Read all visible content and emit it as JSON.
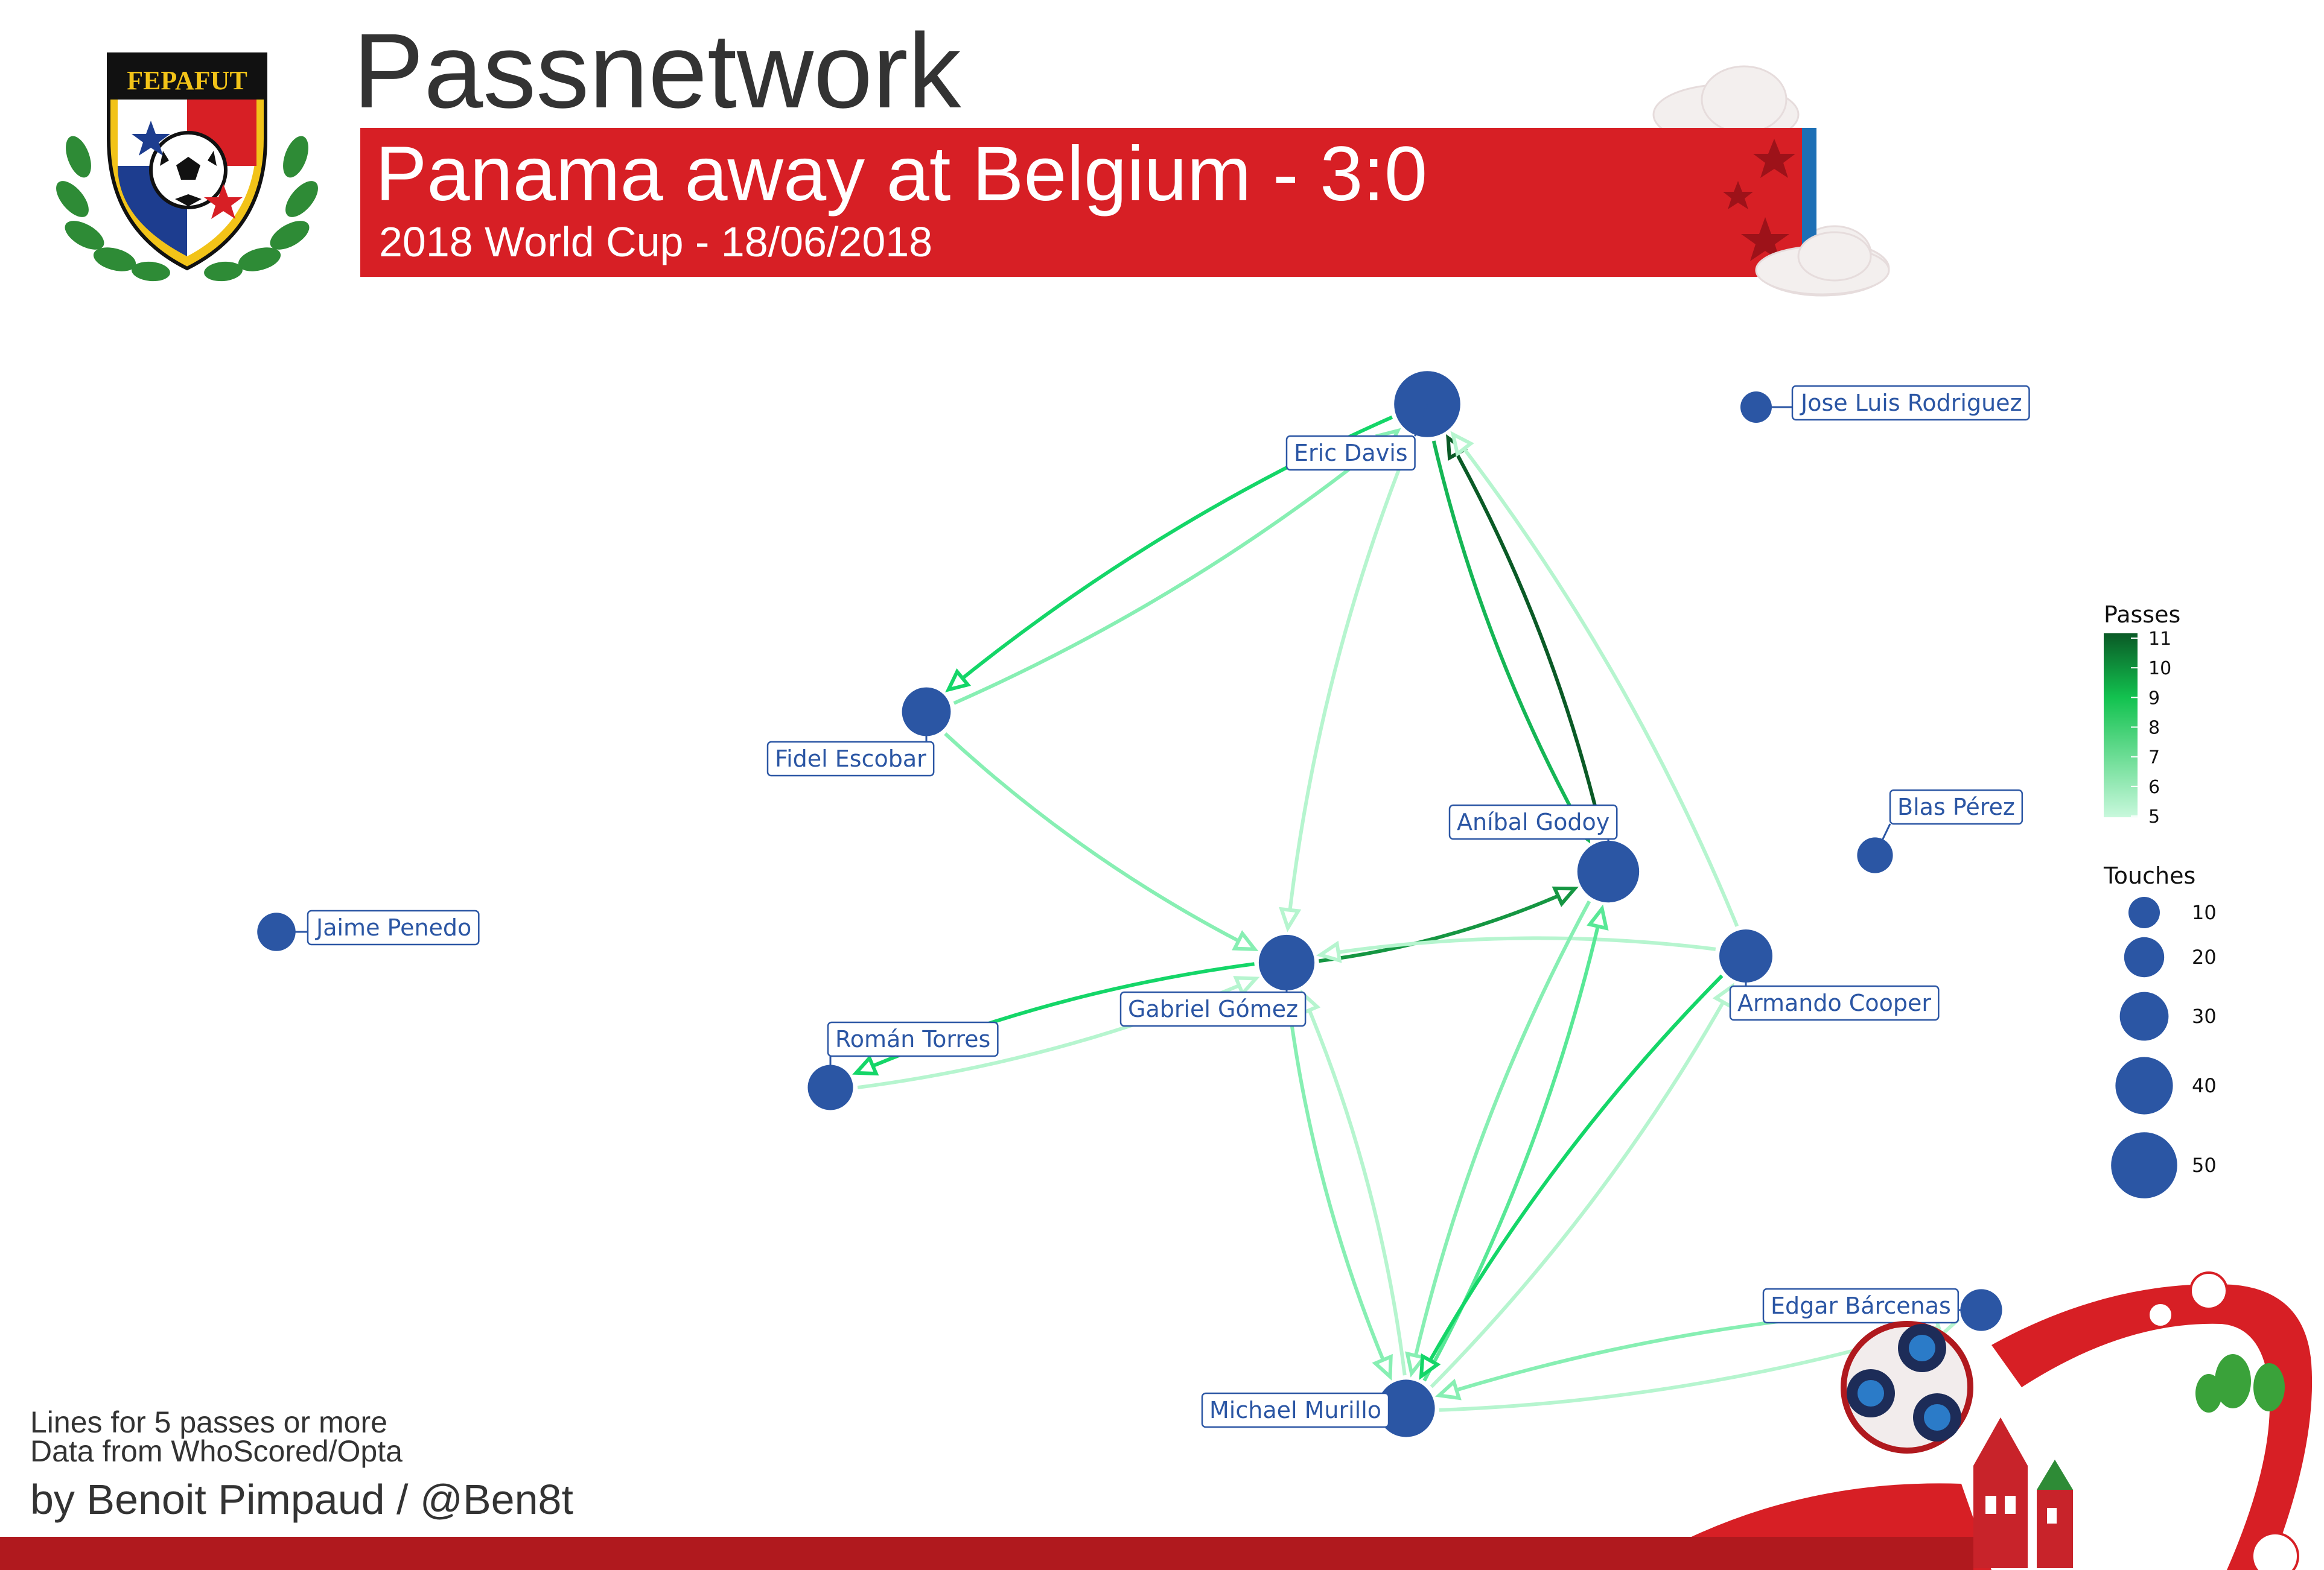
{
  "title": "Passnetwork",
  "banner": {
    "headline": "Panama away at Belgium - 3:0",
    "subline": "2018 World Cup - 18/06/2018"
  },
  "crest_text": "FEPAFUT",
  "footer": {
    "line1": "Lines for 5 passes or more",
    "line2": "Data from WhoScored/Opta",
    "credit": "by Benoit Pimpaud / @Ben8t"
  },
  "colors": {
    "node": "#2b56a4",
    "banner_red": "#d71f25",
    "banner_blue": "#1d6fb5",
    "edge_low": "#b6f5cf",
    "edge_high": "#0a5a26"
  },
  "players": [
    {
      "id": "davis",
      "name": "Eric Davis",
      "touches": 50
    },
    {
      "id": "rodriguez",
      "name": "Jose Luis Rodriguez",
      "touches": 10
    },
    {
      "id": "escobar",
      "name": "Fidel Escobar",
      "touches": 30
    },
    {
      "id": "godoy",
      "name": "Aníbal Godoy",
      "touches": 45
    },
    {
      "id": "perez",
      "name": "Blas Pérez",
      "touches": 15
    },
    {
      "id": "penedo",
      "name": "Jaime Penedo",
      "touches": 18
    },
    {
      "id": "gomez",
      "name": "Gabriel Gómez",
      "touches": 38
    },
    {
      "id": "cooper",
      "name": "Armando Cooper",
      "touches": 35
    },
    {
      "id": "torres",
      "name": "Román Torres",
      "touches": 26
    },
    {
      "id": "barcenas",
      "name": "Edgar Bárcenas",
      "touches": 22
    },
    {
      "id": "murillo",
      "name": "Michael Murillo",
      "touches": 40
    }
  ],
  "passes": [
    {
      "from": "davis",
      "to": "escobar",
      "count": 8
    },
    {
      "from": "escobar",
      "to": "davis",
      "count": 6
    },
    {
      "from": "godoy",
      "to": "davis",
      "count": 11
    },
    {
      "from": "davis",
      "to": "godoy",
      "count": 9
    },
    {
      "from": "davis",
      "to": "gomez",
      "count": 5
    },
    {
      "from": "escobar",
      "to": "gomez",
      "count": 6
    },
    {
      "from": "gomez",
      "to": "godoy",
      "count": 10
    },
    {
      "from": "cooper",
      "to": "davis",
      "count": 5
    },
    {
      "from": "cooper",
      "to": "gomez",
      "count": 5
    },
    {
      "from": "gomez",
      "to": "torres",
      "count": 8
    },
    {
      "from": "torres",
      "to": "gomez",
      "count": 5
    },
    {
      "from": "gomez",
      "to": "murillo",
      "count": 6
    },
    {
      "from": "murillo",
      "to": "gomez",
      "count": 5
    },
    {
      "from": "godoy",
      "to": "murillo",
      "count": 6
    },
    {
      "from": "murillo",
      "to": "godoy",
      "count": 7
    },
    {
      "from": "cooper",
      "to": "murillo",
      "count": 8
    },
    {
      "from": "murillo",
      "to": "cooper",
      "count": 5
    },
    {
      "from": "barcenas",
      "to": "murillo",
      "count": 6
    },
    {
      "from": "murillo",
      "to": "barcenas",
      "count": 5
    }
  ],
  "legend": {
    "passes_title": "Passes",
    "passes_ticks": [
      11,
      10,
      9,
      8,
      7,
      6,
      5
    ],
    "touches_title": "Touches",
    "touches_ticks": [
      10,
      20,
      30,
      40,
      50
    ]
  }
}
